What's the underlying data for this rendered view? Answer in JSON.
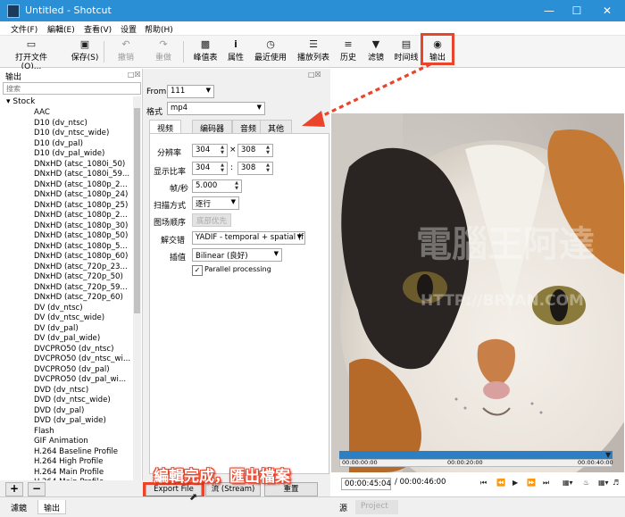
{
  "window": {
    "title": "Untitled - Shotcut"
  },
  "menu": [
    "文件(F)",
    "編輯(E)",
    "查看(V)",
    "设置",
    "帮助(H)"
  ],
  "toolbar": [
    {
      "label": "打开文件(O)...",
      "icon": "open-folder-icon"
    },
    {
      "label": "保存(S)",
      "icon": "save-icon"
    },
    {
      "label": "撤销",
      "icon": "undo-icon",
      "disabled": true
    },
    {
      "label": "重做",
      "icon": "redo-icon",
      "disabled": true
    },
    {
      "label": "峰值表",
      "icon": "peak-meter-icon"
    },
    {
      "label": "属性",
      "icon": "properties-icon"
    },
    {
      "label": "最近使用",
      "icon": "recent-icon"
    },
    {
      "label": "播放列表",
      "icon": "playlist-icon"
    },
    {
      "label": "历史",
      "icon": "history-icon"
    },
    {
      "label": "滤镜",
      "icon": "filter-icon"
    },
    {
      "label": "时间线",
      "icon": "timeline-icon"
    },
    {
      "label": "输出",
      "icon": "export-icon"
    }
  ],
  "left_panel": {
    "title": "输出",
    "search_placeholder": "搜索",
    "tree_header": "Stock",
    "presets": [
      "AAC",
      "D10 (dv_ntsc)",
      "D10 (dv_ntsc_wide)",
      "D10 (dv_pal)",
      "D10 (dv_pal_wide)",
      "DNxHD (atsc_1080i_50)",
      "DNxHD (atsc_1080i_59...",
      "DNxHD (atsc_1080p_2...",
      "DNxHD (atsc_1080p_24)",
      "DNxHD (atsc_1080p_25)",
      "DNxHD (atsc_1080p_2...",
      "DNxHD (atsc_1080p_30)",
      "DNxHD (atsc_1080p_50)",
      "DNxHD (atsc_1080p_5...",
      "DNxHD (atsc_1080p_60)",
      "DNxHD (atsc_720p_23...",
      "DNxHD (atsc_720p_50)",
      "DNxHD (atsc_720p_59...",
      "DNxHD (atsc_720p_60)",
      "DV (dv_ntsc)",
      "DV (dv_ntsc_wide)",
      "DV (dv_pal)",
      "DV (dv_pal_wide)",
      "DVCPRO50 (dv_ntsc)",
      "DVCPRO50 (dv_ntsc_wi...",
      "DVCPRO50 (dv_pal)",
      "DVCPRO50 (dv_pal_wi...",
      "DVD (dv_ntsc)",
      "DVD (dv_ntsc_wide)",
      "DVD (dv_pal)",
      "DVD (dv_pal_wide)",
      "Flash",
      "GIF Animation",
      "H.264 Baseline Profile",
      "H.264 High Profile",
      "H.264 Main Profile",
      "H.264 Main Profile"
    ],
    "add_btn": "+",
    "remove_btn": "−"
  },
  "export": {
    "from_label": "From",
    "from_value": "111",
    "format_label": "格式",
    "format_value": "mp4",
    "tabs": [
      "视频",
      "编码器",
      "音频",
      "其他"
    ],
    "resolution_label": "分辨率",
    "res_w": "304",
    "res_x": "×",
    "res_h": "308",
    "aspect_label": "显示比率",
    "aspect_w": "304",
    "aspect_sep": ":",
    "aspect_h": "308",
    "fps_label": "帧/秒",
    "fps_value": "5.000",
    "scan_label": "扫描方式",
    "scan_value": "逐行",
    "field_label": "图场顺序",
    "field_value": "底部优先",
    "deint_label": "解交错",
    "deint_value": "YADIF - temporal + spatial (f",
    "interp_label": "插值",
    "interp_value": "Bilinear (良好)",
    "parallel_label": "Parallel processing",
    "parallel_checked": "✓",
    "export_file_btn": "Export File",
    "stream_btn": "流 (Stream)",
    "reset_btn": "重置"
  },
  "player": {
    "timecode": "00:00:45:04",
    "duration": "/ 00:00:46:00",
    "ruler": [
      "00:00:00:00",
      "00:00:20:00",
      "00:00:40:00"
    ]
  },
  "bottom_tabs": [
    "濾鏡",
    "输出"
  ],
  "viewer_tabs": [
    "源",
    "Project"
  ],
  "annotation": "編輯完成，匯出檔案",
  "watermark": [
    "電腦王阿達",
    "HTTP://BRYAN.COM"
  ],
  "colors": {
    "titlebar": "#2b8fd6",
    "highlight": "#e8452c",
    "timeline": "#2d7fc4"
  }
}
